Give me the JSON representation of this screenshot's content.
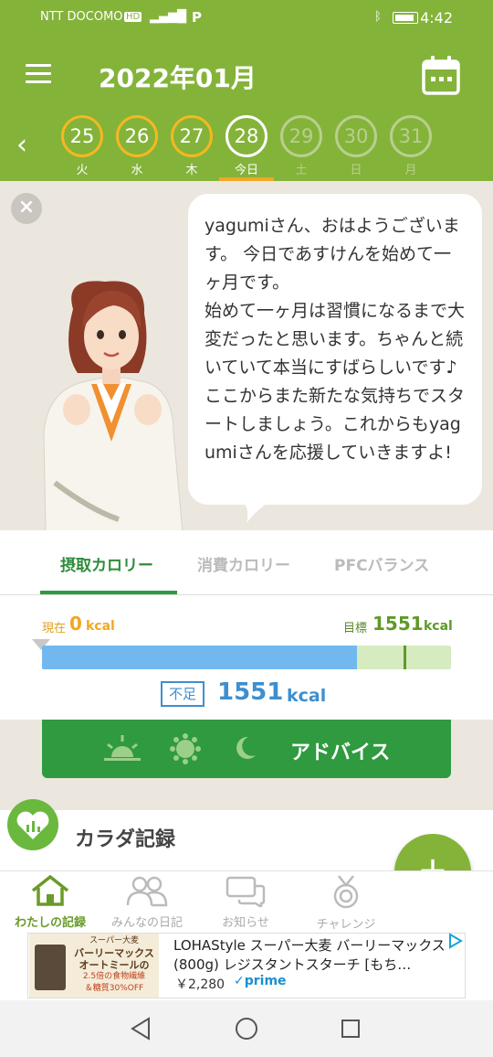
{
  "status_bar": {
    "carrier": "NTT DOCOMO",
    "hd": "HD",
    "parking": "P",
    "time": "4:42"
  },
  "header": {
    "month_title": "2022年01月",
    "days": [
      {
        "num": "25",
        "label": "火",
        "state": "past"
      },
      {
        "num": "26",
        "label": "水",
        "state": "past"
      },
      {
        "num": "27",
        "label": "木",
        "state": "past"
      },
      {
        "num": "28",
        "label": "今日",
        "state": "today"
      },
      {
        "num": "29",
        "label": "土",
        "state": "future"
      },
      {
        "num": "30",
        "label": "日",
        "state": "future"
      },
      {
        "num": "31",
        "label": "月",
        "state": "future"
      }
    ]
  },
  "message": {
    "text": "yagumiさん、おはようございます。 今日であすけんを始めて一ヶ月です。\n始めて一ヶ月は習慣になるまで大変だったと思います。ちゃんと続いていて本当にすばらしいです♪ここからまた新たな気持ちでスタートしましょう。これからもyagumiさんを応援していきますよ!"
  },
  "tabs": [
    {
      "label": "摂取カロリー",
      "active": true
    },
    {
      "label": "消費カロリー",
      "active": false
    },
    {
      "label": "PFCバランス",
      "active": false
    }
  ],
  "calorie": {
    "current_label": "現在",
    "current_value": "0",
    "target_label": "目標",
    "target_value": "1551",
    "unit": "kcal",
    "bar_fill_fraction": 0.77,
    "shortage_label": "不足",
    "shortage_value": "1551"
  },
  "advice": {
    "label": "アドバイス",
    "icons": [
      "sunrise-icon",
      "sun-icon",
      "moon-icon"
    ]
  },
  "body_record": {
    "title": "カラダ記録"
  },
  "bottom_nav": [
    {
      "label": "わたしの記録",
      "icon": "home-icon",
      "active": true
    },
    {
      "label": "みんなの日記",
      "icon": "people-icon",
      "active": false
    },
    {
      "label": "お知らせ",
      "icon": "chat-icon",
      "active": false
    },
    {
      "label": "チャレンジ",
      "icon": "medal-icon",
      "active": false
    }
  ],
  "ad": {
    "image_lines": [
      "スーパー大麦",
      "バーリーマックス",
      "オートミールの",
      "2.5倍の食物繊維",
      "＆糖質30%OFF"
    ],
    "title": "LOHAStyle スーパー大麦 バーリーマックス (800g) レジスタントスターチ [もち…",
    "price": "￥2,280",
    "prime": "prime"
  },
  "colors": {
    "header_green": "#84b33a",
    "accent_orange": "#f5b820",
    "advice_green": "#2f9a3f",
    "bar_blue": "#72b8ef",
    "shortage_blue": "#3d8fd0"
  }
}
